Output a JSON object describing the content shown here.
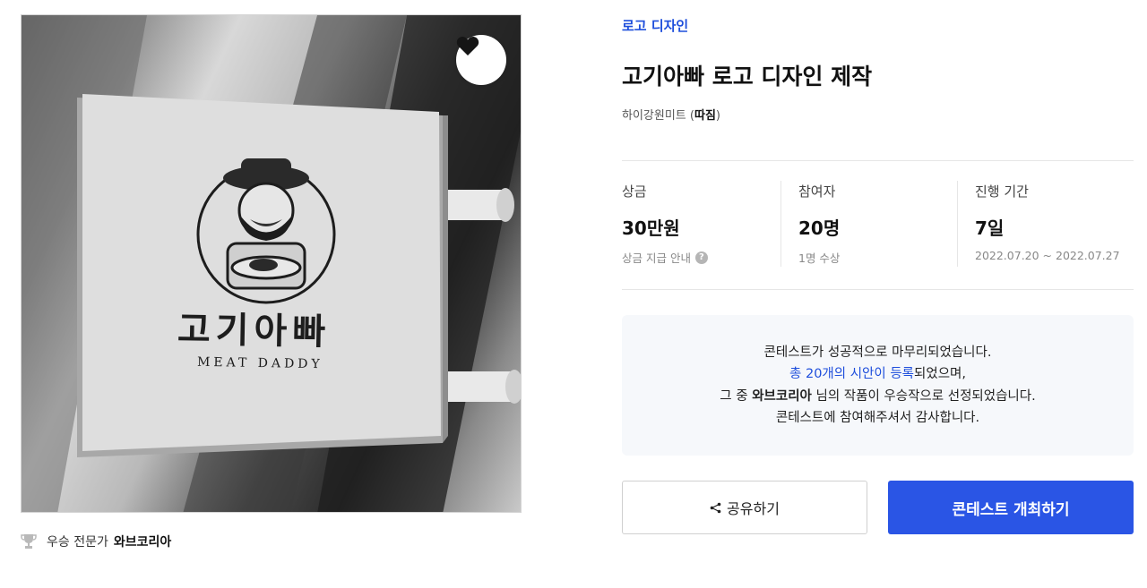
{
  "image": {
    "sign_title": "고기아빠",
    "sign_subtitle": "MEAT DADDY"
  },
  "favorite": {
    "icon": "heart-icon"
  },
  "winner": {
    "icon": "trophy-icon",
    "label": "우승 전문가",
    "name": "와브코리아"
  },
  "contest": {
    "category": "로고 디자인",
    "title": "고기아빠 로고 디자인 제작",
    "host_name": "하이강원미트",
    "host_prefix": "(",
    "host_badge": "따짐",
    "host_suffix": ")"
  },
  "stats": {
    "prize": {
      "label": "상금",
      "value": "30만원",
      "sub": "상금 지급 안내",
      "icon": "help-icon",
      "icon_glyph": "?"
    },
    "participants": {
      "label": "참여자",
      "value": "20명",
      "sub": "1명 수상"
    },
    "period": {
      "label": "진행 기간",
      "value": "7일",
      "sub": "2022.07.20 ~ 2022.07.27"
    }
  },
  "result": {
    "line1": "콘테스트가 성공적으로 마무리되었습니다.",
    "line2_link": "총 20개의 시안이 등록",
    "line2_rest": "되었으며,",
    "line3_pre": "그 중 ",
    "line3_name": "와브코리아",
    "line3_post": " 님의 작품이 우승작으로 선정되었습니다.",
    "line4": "콘테스트에 참여해주셔서 감사합니다."
  },
  "actions": {
    "share_label": "공유하기",
    "share_icon": "share-icon",
    "open_label": "콘테스트 개최하기"
  },
  "colors": {
    "accent": "#2a55e5",
    "link": "#1f4fdc",
    "panel_bg": "#f6f8fb"
  }
}
